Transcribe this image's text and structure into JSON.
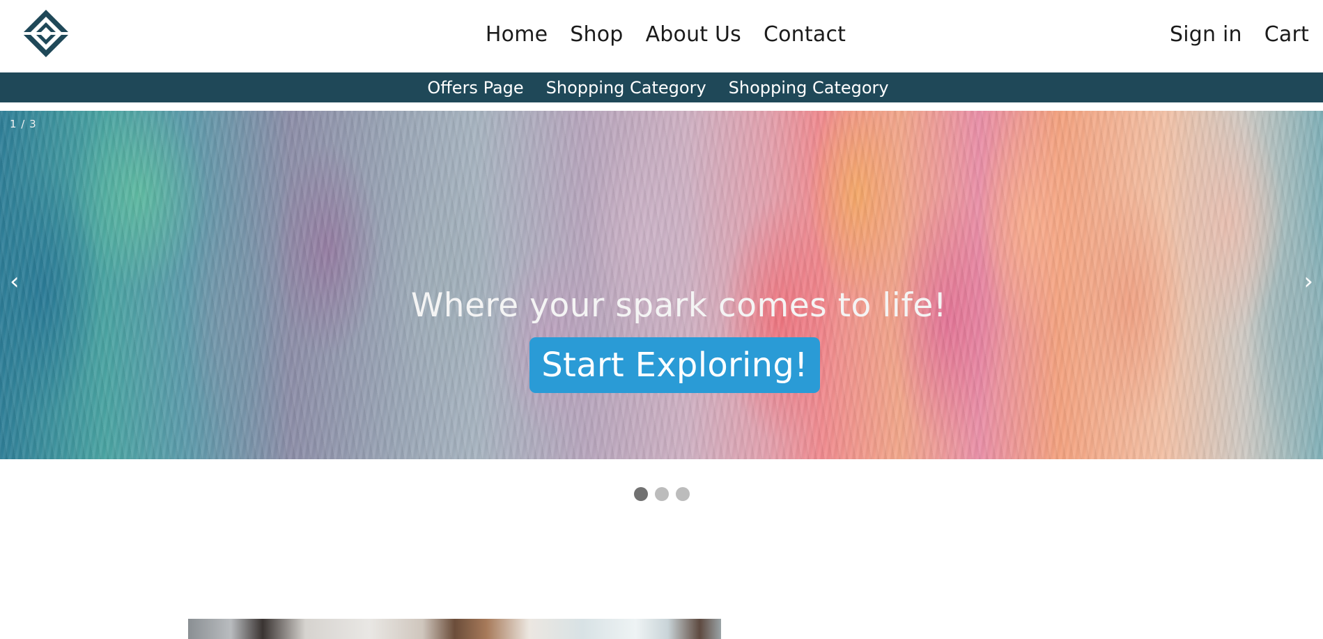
{
  "header": {
    "logo_icon": "diamond-logo-icon",
    "logo_color": "#1f4858",
    "nav": [
      "Home",
      "Shop",
      "About Us",
      "Contact"
    ],
    "right_nav": [
      "Sign in",
      "Cart"
    ]
  },
  "subnav": {
    "background": "#1f4858",
    "items": [
      "Offers Page",
      "Shopping Category",
      "Shopping Category"
    ]
  },
  "hero": {
    "slide_counter": "1 / 3",
    "prev_icon": "chevron-left-icon",
    "next_icon": "chevron-right-icon",
    "prev_glyph": "‹",
    "next_glyph": "›",
    "caption": "Where your spark comes to life!",
    "cta_label": "Start Exploring!",
    "cta_color": "#2a9bd6"
  },
  "carousel": {
    "slide_count": 3,
    "active_index": 0
  }
}
